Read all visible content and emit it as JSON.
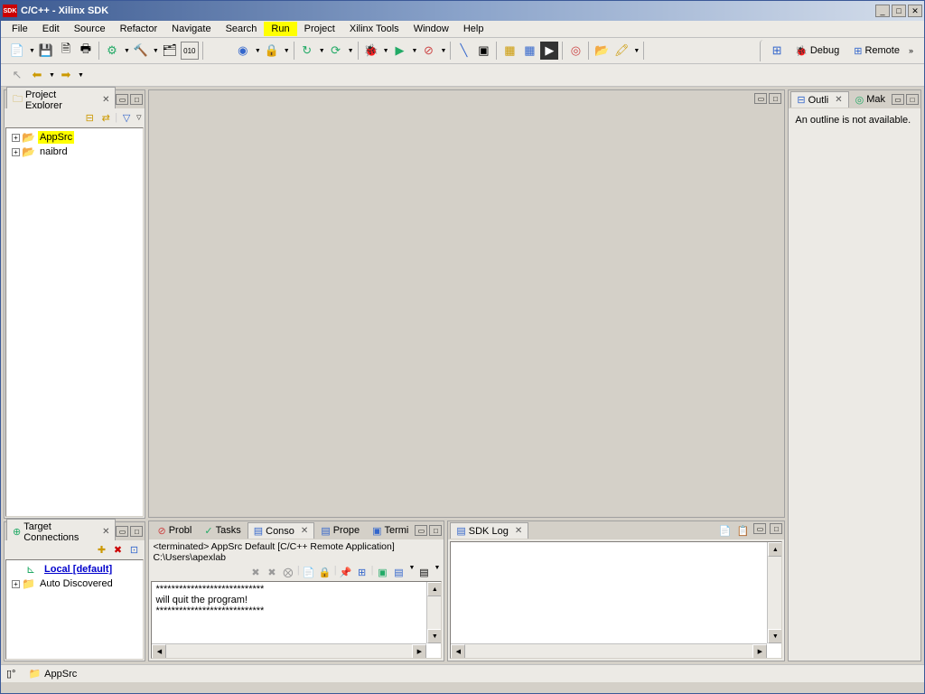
{
  "title": "C/C++ - Xilinx SDK",
  "title_icon": "SDK",
  "menu": [
    "File",
    "Edit",
    "Source",
    "Refactor",
    "Navigate",
    "Search",
    "Run",
    "Project",
    "Xilinx Tools",
    "Window",
    "Help"
  ],
  "menu_highlighted": "Run",
  "perspectives": {
    "debug": "Debug",
    "remote": "Remote"
  },
  "project_explorer": {
    "title": "Project Explorer",
    "items": [
      {
        "label": "AppSrc",
        "highlighted": true
      },
      {
        "label": "naibrd",
        "highlighted": false
      }
    ]
  },
  "target_connections": {
    "title": "Target Connections",
    "items": [
      {
        "label": "Local [default]",
        "link": true
      },
      {
        "label": "Auto Discovered",
        "link": false
      }
    ]
  },
  "outline": {
    "tab1": "Outli",
    "tab2": "Mak",
    "message": "An outline is not available."
  },
  "bottom_tabs": {
    "probl": "Probl",
    "tasks": "Tasks",
    "conso": "Conso",
    "prope": "Prope",
    "termi": "Termi"
  },
  "console": {
    "header": "<terminated> AppSrc Default [C/C++ Remote Application] C:\\Users\\apexlab",
    "lines": [
      "****************************",
      " will quit the program!",
      "****************************",
      ""
    ]
  },
  "sdk_log": {
    "title": "SDK Log"
  },
  "status": {
    "item1_icon": "▯°",
    "item2_icon": "📁",
    "item2_text": "AppSrc"
  }
}
